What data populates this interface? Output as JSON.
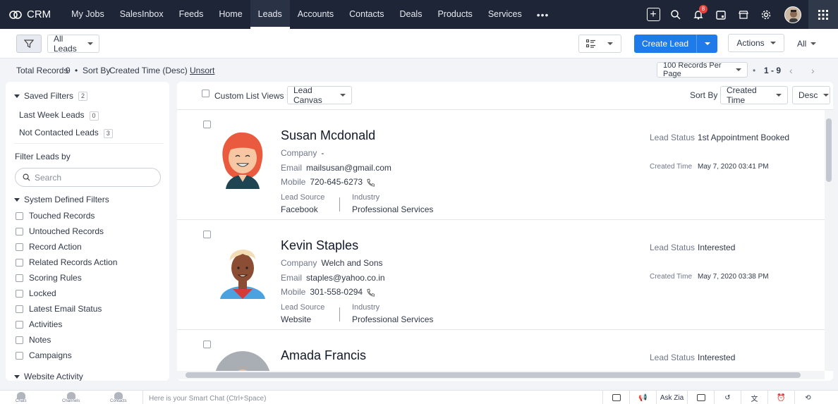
{
  "nav": {
    "brand": "CRM",
    "items": [
      "My Jobs",
      "SalesInbox",
      "Feeds",
      "Home",
      "Leads",
      "Accounts",
      "Contacts",
      "Deals",
      "Products",
      "Services"
    ],
    "active": "Leads",
    "more": "•••",
    "notif_count": "8"
  },
  "toolbar": {
    "view_select": "All Leads",
    "create_label": "Create Lead",
    "actions_label": "Actions",
    "all_label": "All"
  },
  "info": {
    "total_label": "Total Records",
    "total": "9",
    "sort_label": "Sort By",
    "sort_value": "Created Time (Desc)",
    "unsort": "Unsort",
    "per_page": "100 Records Per Page",
    "range": "1 - 9"
  },
  "sidebar": {
    "saved_filters_title": "Saved Filters",
    "saved_filters_count": "2",
    "saved": [
      {
        "label": "Last Week Leads",
        "count": "0"
      },
      {
        "label": "Not Contacted Leads",
        "count": "3"
      }
    ],
    "filter_by": "Filter Leads by",
    "search_placeholder": "Search",
    "system_title": "System Defined Filters",
    "system": [
      "Touched Records",
      "Untouched Records",
      "Record Action",
      "Related Records Action",
      "Scoring Rules",
      "Locked",
      "Latest Email Status",
      "Activities",
      "Notes",
      "Campaigns"
    ],
    "website_title": "Website Activity"
  },
  "list": {
    "custom_views_label": "Custom List Views :",
    "canvas": "Lead Canvas",
    "sort_by": "Sort By",
    "sort_field": "Created Time",
    "sort_dir": "Desc",
    "labels": {
      "company": "Company",
      "email": "Email",
      "mobile": "Mobile",
      "lead_source": "Lead Source",
      "industry": "Industry",
      "lead_status": "Lead Status",
      "created_time": "Created Time"
    },
    "leads": [
      {
        "name": "Susan Mcdonald",
        "company": "-",
        "email": "mailsusan@gmail.com",
        "mobile": "720-645-6273",
        "source": "Facebook",
        "industry": "Professional Services",
        "status": "1st Appointment Booked",
        "created": "May 7, 2020 03:41 PM"
      },
      {
        "name": "Kevin Staples",
        "company": "Welch and Sons",
        "email": "staples@yahoo.co.in",
        "mobile": "301-558-0294",
        "source": "Website",
        "industry": "Professional Services",
        "status": "Interested",
        "created": "May 7, 2020 03:38 PM"
      },
      {
        "name": "Amada Francis",
        "status": "Interested"
      }
    ]
  },
  "bottom": {
    "chats": "Chats",
    "channels": "Channels",
    "contacts": "Contacts",
    "smartchat": "Here is your Smart Chat (Ctrl+Space)",
    "ask_zia": "Ask Zia"
  }
}
